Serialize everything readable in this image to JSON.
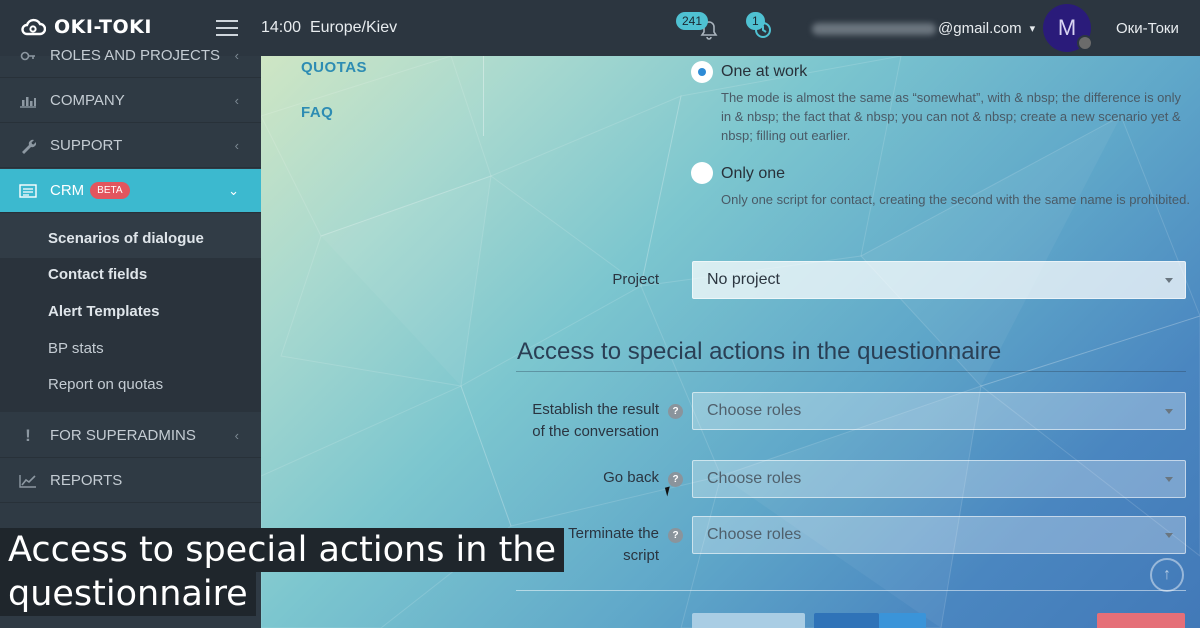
{
  "topbar": {
    "brand": "OKI-TOKI",
    "time": "14:00",
    "timezone": "Europe/Kiev",
    "notifications_count": "241",
    "history_count": "1",
    "email_visible": "@gmail.com",
    "avatar_letter": "M",
    "username": "Оки-Токи"
  },
  "sidebar": {
    "items": [
      {
        "label": "ROLES AND PROJECTS",
        "icon": "key-icon"
      },
      {
        "label": "COMPANY",
        "icon": "bar-chart-icon"
      },
      {
        "label": "SUPPORT",
        "icon": "wrench-icon"
      },
      {
        "label": "CRM",
        "icon": "list-card-icon",
        "badge": "BETA"
      },
      {
        "label": "FOR SUPERADMINS",
        "icon": "exclamation-icon"
      },
      {
        "label": "REPORTS",
        "icon": "line-chart-icon"
      }
    ],
    "submenu": [
      "Scenarios of dialogue",
      "Contact fields",
      "Alert Templates",
      "BP stats",
      "Report on quotas"
    ]
  },
  "toc": [
    "QUOTAS",
    "FAQ"
  ],
  "options": [
    {
      "title": "One at work",
      "checked": true,
      "desc": "The mode is almost the same as “somewhat”, with & nbsp; the difference is only in & nbsp; the fact that & nbsp; you can not & nbsp; create a new scenario yet & nbsp; filling out earlier."
    },
    {
      "title": "Only one",
      "checked": false,
      "desc": "Only one script for contact, creating the second with the same name is prohibited."
    }
  ],
  "project": {
    "label": "Project",
    "value": "No project"
  },
  "section": {
    "title": "Access to special actions in the questionnaire",
    "fields": [
      {
        "label_line1": "Establish the result",
        "label_line2": "of the conversation",
        "placeholder": "Choose roles"
      },
      {
        "label_line1": "Go back",
        "label_line2": "",
        "placeholder": "Choose roles"
      },
      {
        "label_line1": "Terminate the",
        "label_line2": "script",
        "placeholder": "Choose roles"
      }
    ]
  },
  "caption": {
    "line1": "Access to special actions in the",
    "line2": "questionnaire"
  },
  "colors": {
    "accent": "#3cb9cf",
    "sidebar": "#2f3a44",
    "beta": "#e2555e",
    "link": "#2d8cb3"
  }
}
